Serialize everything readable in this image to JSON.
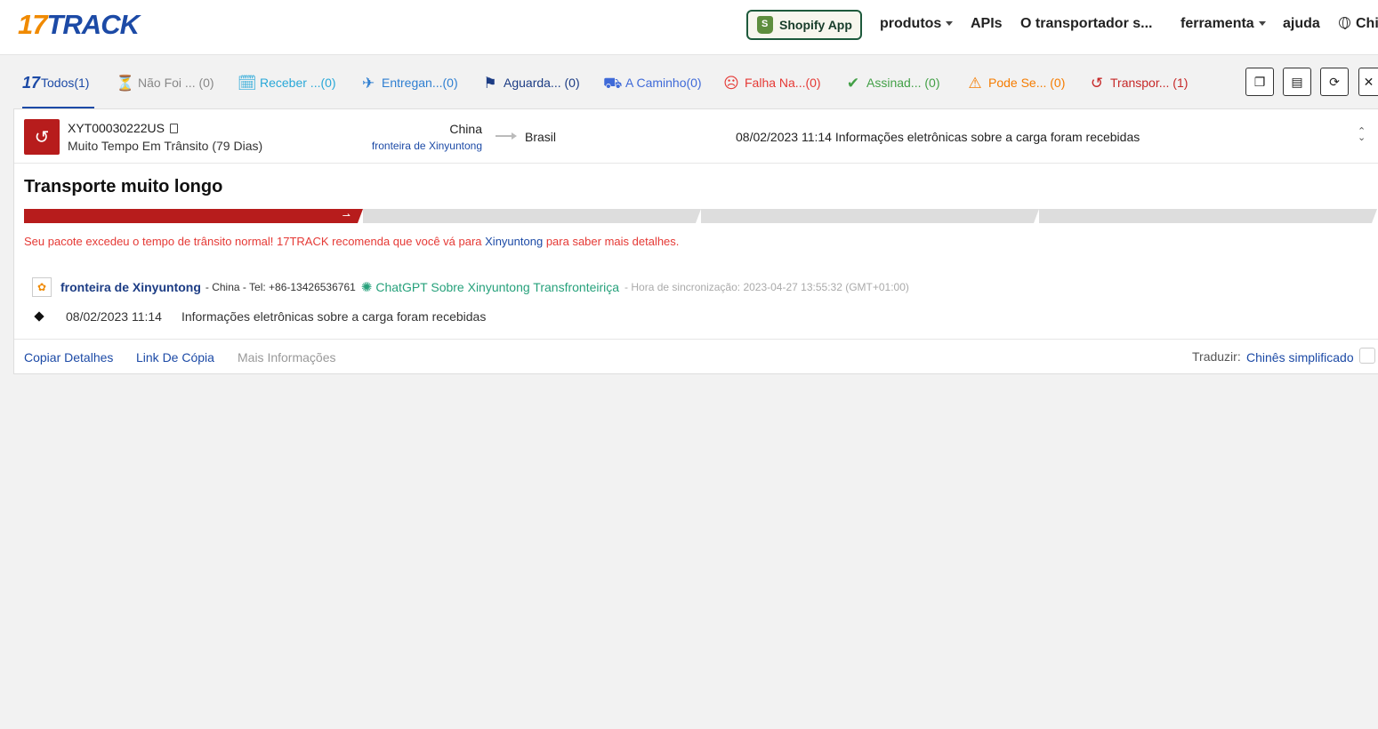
{
  "header": {
    "logo_num": "17",
    "logo_text": "TRACK",
    "shopify_label": "Shopify App",
    "nav": [
      "produtos",
      "APIs",
      "O transportador s...",
      "ferramenta",
      "ajuda",
      "Chi"
    ]
  },
  "tabs": [
    {
      "label": "Todos(1)",
      "icon": "17-logo-icon",
      "color": "#1c4aa6"
    },
    {
      "label": "Não Foi ...  (0)",
      "icon": "hourglass-icon",
      "color": "#888888"
    },
    {
      "label": "Receber ...(0)",
      "icon": "receive-clock-icon",
      "color": "#29a8d8"
    },
    {
      "label": "Entregan...(0)",
      "icon": "airplane-icon",
      "color": "#2f7fd1"
    },
    {
      "label": "Aguarda...  (0)",
      "icon": "flag-icon",
      "color": "#1c3c84"
    },
    {
      "label": "A Caminho(0)",
      "icon": "delivery-icon",
      "color": "#3f6ad8"
    },
    {
      "label": "Falha Na...(0)",
      "icon": "sad-face-icon",
      "color": "#e53935"
    },
    {
      "label": "Assinad...  (0)",
      "icon": "check-icon",
      "color": "#43a047"
    },
    {
      "label": "Pode Se...  (0)",
      "icon": "warning-icon",
      "color": "#f57c00"
    },
    {
      "label": "Transpor...  (1)",
      "icon": "history-icon",
      "color": "#c62828"
    }
  ],
  "shipment": {
    "tracking_number": "XYT00030222US",
    "status_text": "Muito Tempo Em Trânsito (79 Dias)",
    "origin_country": "China",
    "origin_carrier": "fronteira de Xinyuntong",
    "destination": "Brasil",
    "last_event_time": "08/02/2023 11:14",
    "last_event_desc": "Informações eletrônicas sobre a carga foram recebidas"
  },
  "detail": {
    "headline": "Transporte muito longo",
    "progress_steps": 4,
    "progress_current": 1,
    "warning_pre": "Seu pacote excedeu o tempo de trânsito normal! 17TRACK recomenda que você vá para ",
    "warning_link": "Xinyuntong",
    "warning_post": " para saber mais detalhes.",
    "carrier_name": "fronteira de Xinyuntong",
    "carrier_info": "- China - Tel: +86-13426536761",
    "chatgpt_label": "ChatGPT Sobre Xinyuntong Transfronteiriça",
    "sync_text": "- Hora de sincronização: 2023-04-27 13:55:32 (GMT+01:00)",
    "events": [
      {
        "time": "08/02/2023 11:14",
        "desc": "Informações eletrônicas sobre a carga foram recebidas"
      }
    ]
  },
  "footer": {
    "copy_details": "Copiar Detalhes",
    "copy_link": "Link De Cópia",
    "more_info": "Mais Informações",
    "translate_label": "Traduzir:",
    "translate_value": "Chinês simplificado"
  },
  "colors": {
    "brand_blue": "#1c4aa6",
    "brand_orange": "#f08a00",
    "alert_red": "#b71c1c",
    "warning_text": "#e53935",
    "chatgpt_green": "#26a17b"
  }
}
